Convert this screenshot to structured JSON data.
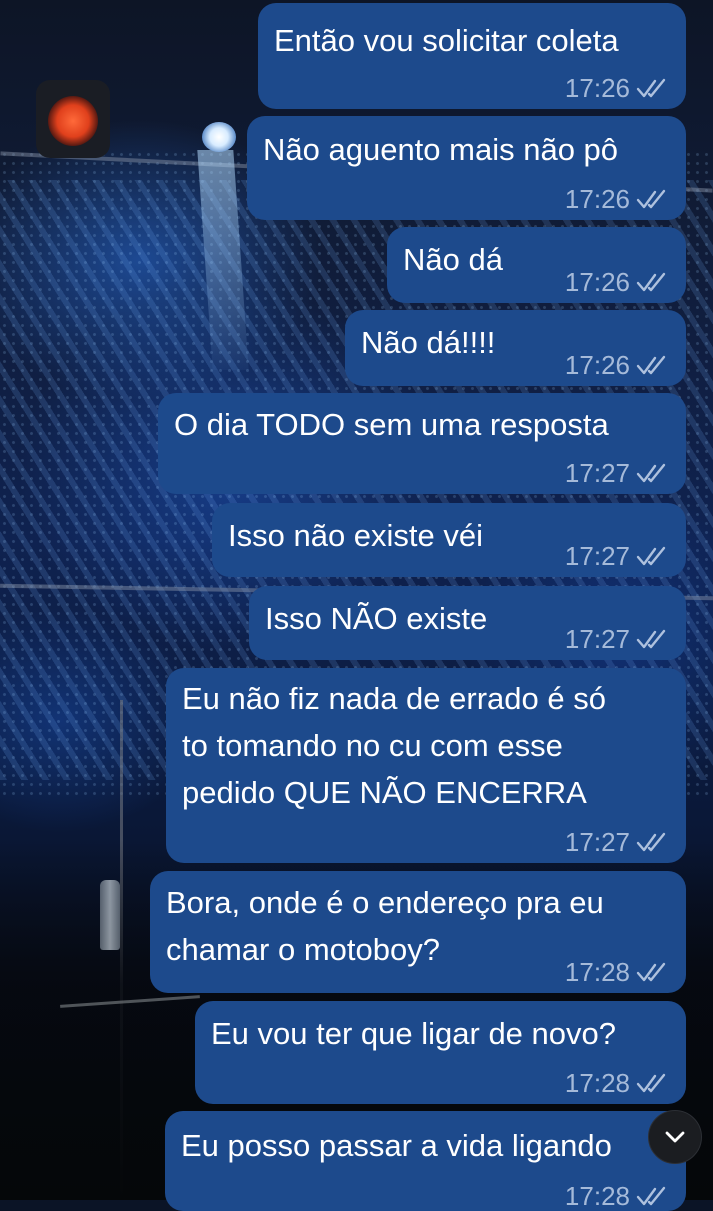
{
  "messages": [
    {
      "text": "Então vou solicitar coleta",
      "time": "17:26"
    },
    {
      "text": "Não aguento mais não pô",
      "time": "17:26"
    },
    {
      "text": "Não dá",
      "time": "17:26"
    },
    {
      "text": "Não dá!!!!",
      "time": "17:26"
    },
    {
      "text": "O dia TODO sem uma resposta",
      "time": "17:27"
    },
    {
      "text": "Isso não existe véi",
      "time": "17:27"
    },
    {
      "text": "Isso NÃO existe",
      "time": "17:27"
    },
    {
      "text": "Eu não fiz nada de errado é só\nto tomando no cu com esse\npedido QUE NÃO ENCERRA",
      "time": "17:27"
    },
    {
      "text": "Bora, onde é o endereço pra eu\nchamar o motoboy?",
      "time": "17:28"
    },
    {
      "text": "Eu vou ter que ligar de novo?",
      "time": "17:28"
    },
    {
      "text": "Eu posso passar a vida ligando",
      "time": "17:28"
    }
  ],
  "read_receipt_icon": "double-check-icon",
  "scroll_button_icon": "chevron-down-icon",
  "colors": {
    "bubble": "#1d4a8c",
    "message_text": "#ffffff",
    "time_text": "#c8d6ec",
    "scroll_button": "#1b1d21"
  }
}
